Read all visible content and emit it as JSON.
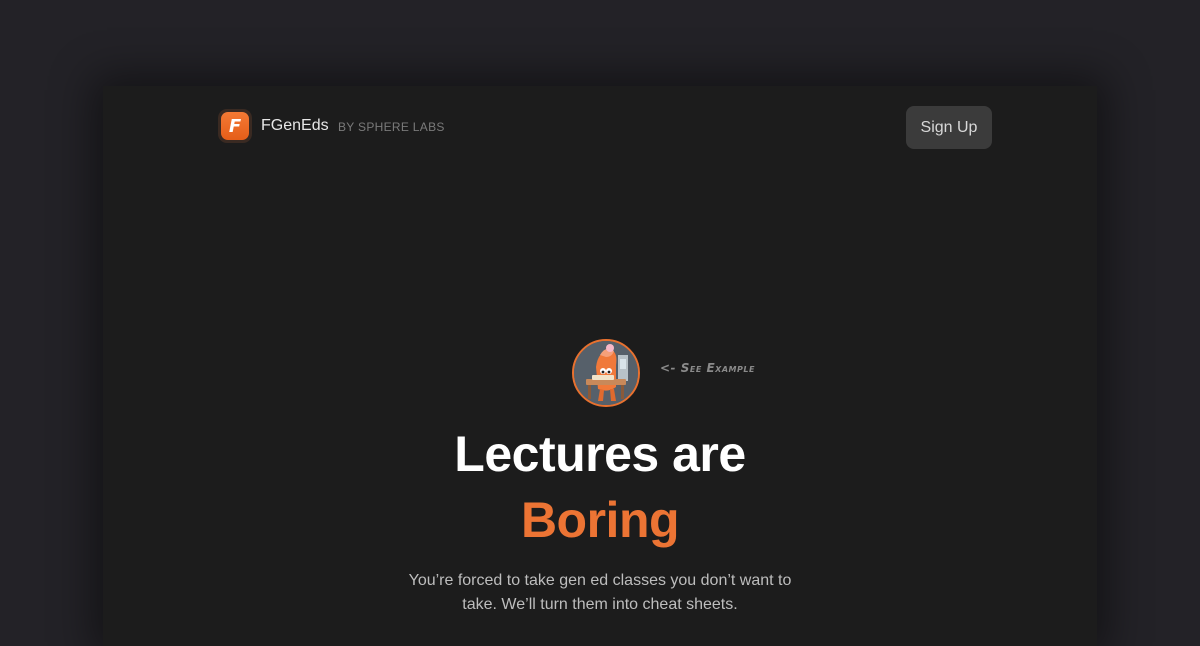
{
  "brand": {
    "logo_letter": "F",
    "name": "FGenEds",
    "byline": "BY SPHERE LABS"
  },
  "nav": {
    "signup_label": "Sign Up"
  },
  "hero": {
    "example_link": "<- See Example",
    "headline_line1": "Lectures are",
    "headline_line2": "Boring",
    "subtext": "You’re forced to take gen ed classes you don’t want to take. We’ll turn them into cheat sheets."
  },
  "colors": {
    "accent": "#ec7434",
    "page_background": "#232227",
    "panel_background": "#1c1c1c",
    "button_background": "#3b3b3b"
  }
}
